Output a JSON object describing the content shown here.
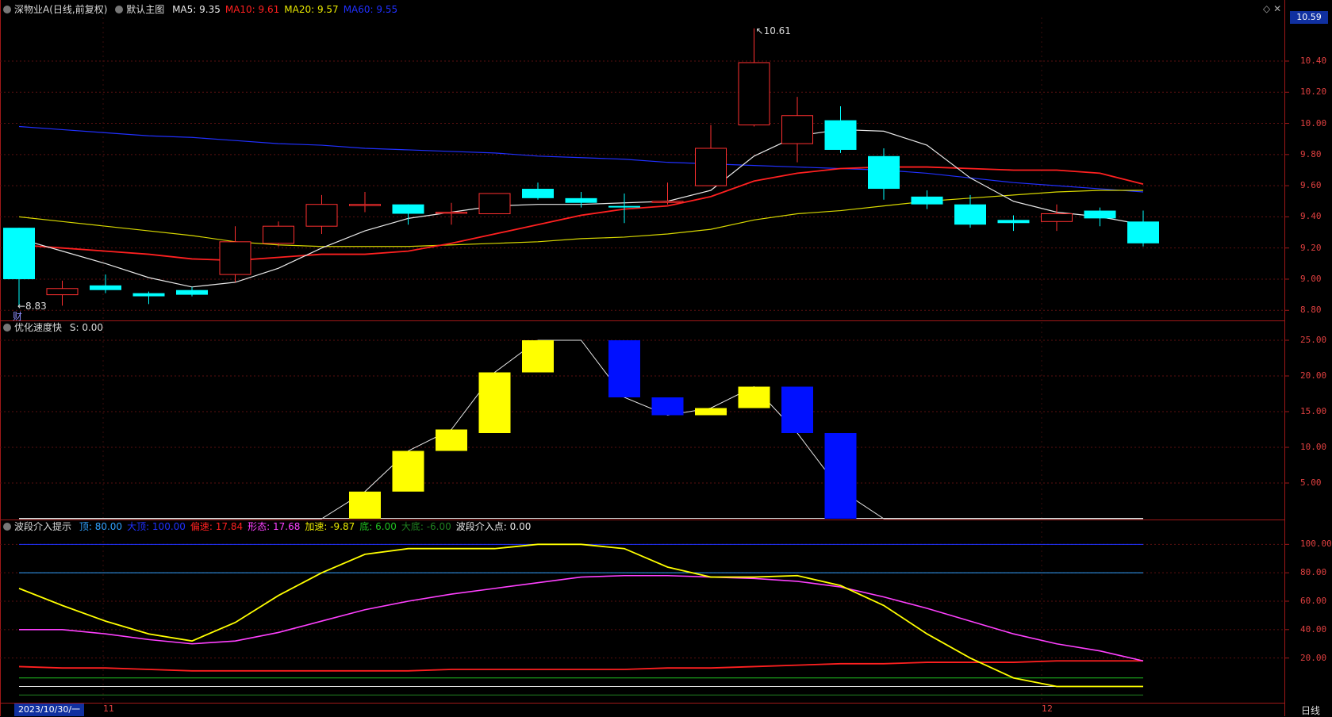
{
  "panel1": {
    "title": "深物业A(日线,前复权)",
    "subtitle": "默认主图",
    "indicators": [
      {
        "label": "MA5: 9.35",
        "color": "#e8e8e8"
      },
      {
        "label": "MA10: 9.61",
        "color": "#ff2020"
      },
      {
        "label": "MA20: 9.57",
        "color": "#e8e800"
      },
      {
        "label": "MA60: 9.55",
        "color": "#2030ff"
      }
    ],
    "current_price": "10.59",
    "high_mark": "10.61",
    "low_mark": "←8.83",
    "cai_mark": "财",
    "y_ticks": [
      "10.40",
      "10.20",
      "10.00",
      "9.80",
      "9.60",
      "9.40",
      "9.20",
      "9.00",
      "8.80"
    ]
  },
  "panel2": {
    "title": "优化速度快",
    "value": "S: 0.00",
    "y_ticks": [
      "25.00",
      "20.00",
      "15.00",
      "10.00",
      "5.00"
    ]
  },
  "panel3": {
    "title": "波段介入提示",
    "indicators": [
      {
        "label": "顶: 80.00",
        "color": "#30a0ff"
      },
      {
        "label": "大顶: 100.00",
        "color": "#2030ff"
      },
      {
        "label": "偏速: 17.84",
        "color": "#ff2020"
      },
      {
        "label": "形态: 17.68",
        "color": "#ff40ff"
      },
      {
        "label": "加速: -9.87",
        "color": "#e8e800"
      },
      {
        "label": "底: 6.00",
        "color": "#20c020"
      },
      {
        "label": "大底: -6.00",
        "color": "#208020"
      },
      {
        "label": "波段介入点: 0.00",
        "color": "#e8e8e8"
      }
    ],
    "y_ticks": [
      "100.00",
      "80.00",
      "60.00",
      "40.00",
      "20.00"
    ]
  },
  "footer": {
    "date": "2023/10/30/一",
    "month_11": "11",
    "month_12": "12",
    "period": "日线"
  },
  "colors": {
    "up": "#ff3030",
    "down": "#00ffff",
    "yellow": "#ffff00",
    "blue": "#0010ff"
  },
  "chart_data": {
    "type": "candlestick",
    "candles": [
      {
        "o": 9.33,
        "c": 9.0,
        "h": 9.33,
        "l": 8.83
      },
      {
        "o": 8.9,
        "c": 8.94,
        "h": 8.99,
        "l": 8.83
      },
      {
        "o": 8.96,
        "c": 8.93,
        "h": 9.03,
        "l": 8.91
      },
      {
        "o": 8.91,
        "c": 8.89,
        "h": 8.92,
        "l": 8.84
      },
      {
        "o": 8.93,
        "c": 8.9,
        "h": 8.95,
        "l": 8.89
      },
      {
        "o": 9.03,
        "c": 9.24,
        "h": 9.34,
        "l": 8.98
      },
      {
        "o": 9.23,
        "c": 9.34,
        "h": 9.37,
        "l": 9.21
      },
      {
        "o": 9.34,
        "c": 9.48,
        "h": 9.54,
        "l": 9.29
      },
      {
        "o": 9.48,
        "c": 9.48,
        "h": 9.56,
        "l": 9.43
      },
      {
        "o": 9.48,
        "c": 9.42,
        "h": 9.48,
        "l": 9.35
      },
      {
        "o": 9.43,
        "c": 9.43,
        "h": 9.49,
        "l": 9.35
      },
      {
        "o": 9.42,
        "c": 9.55,
        "h": 9.55,
        "l": 9.42
      },
      {
        "o": 9.58,
        "c": 9.52,
        "h": 9.62,
        "l": 9.51
      },
      {
        "o": 9.52,
        "c": 9.49,
        "h": 9.56,
        "l": 9.46
      },
      {
        "o": 9.47,
        "c": 9.46,
        "h": 9.55,
        "l": 9.36
      },
      {
        "o": 9.5,
        "c": 9.5,
        "h": 9.62,
        "l": 9.48
      },
      {
        "o": 9.6,
        "c": 9.84,
        "h": 9.99,
        "l": 9.6
      },
      {
        "o": 9.99,
        "c": 10.39,
        "h": 10.61,
        "l": 9.98
      },
      {
        "o": 9.87,
        "c": 10.05,
        "h": 10.17,
        "l": 9.75
      },
      {
        "o": 10.02,
        "c": 9.83,
        "h": 10.11,
        "l": 9.81
      },
      {
        "o": 9.79,
        "c": 9.58,
        "h": 9.84,
        "l": 9.51
      },
      {
        "o": 9.53,
        "c": 9.48,
        "h": 9.57,
        "l": 9.45
      },
      {
        "o": 9.48,
        "c": 9.35,
        "h": 9.54,
        "l": 9.33
      },
      {
        "o": 9.38,
        "c": 9.36,
        "h": 9.41,
        "l": 9.31
      },
      {
        "o": 9.37,
        "c": 9.42,
        "h": 9.48,
        "l": 9.31
      },
      {
        "o": 9.44,
        "c": 9.39,
        "h": 9.46,
        "l": 9.34
      },
      {
        "o": 9.37,
        "c": 9.23,
        "h": 9.44,
        "l": 9.21
      }
    ],
    "ma5": [
      9.26,
      9.18,
      9.1,
      9.01,
      8.95,
      8.98,
      9.07,
      9.2,
      9.31,
      9.39,
      9.43,
      9.47,
      9.48,
      9.48,
      9.49,
      9.5,
      9.57,
      9.79,
      9.92,
      9.96,
      9.95,
      9.86,
      9.65,
      9.5,
      9.43,
      9.4,
      9.35
    ],
    "ma10": [
      9.22,
      9.2,
      9.18,
      9.16,
      9.13,
      9.12,
      9.14,
      9.16,
      9.16,
      9.18,
      9.23,
      9.29,
      9.35,
      9.41,
      9.45,
      9.47,
      9.53,
      9.63,
      9.68,
      9.71,
      9.72,
      9.72,
      9.71,
      9.7,
      9.7,
      9.68,
      9.61
    ],
    "ma20": [
      9.4,
      9.37,
      9.34,
      9.31,
      9.28,
      9.24,
      9.22,
      9.21,
      9.21,
      9.21,
      9.22,
      9.23,
      9.24,
      9.26,
      9.27,
      9.29,
      9.32,
      9.38,
      9.42,
      9.44,
      9.47,
      9.5,
      9.52,
      9.54,
      9.56,
      9.57,
      9.57
    ],
    "ma60": [
      9.98,
      9.96,
      9.94,
      9.92,
      9.91,
      9.89,
      9.87,
      9.86,
      9.84,
      9.83,
      9.82,
      9.81,
      9.79,
      9.78,
      9.77,
      9.75,
      9.74,
      9.73,
      9.72,
      9.71,
      9.7,
      9.68,
      9.65,
      9.62,
      9.6,
      9.58,
      9.56
    ],
    "speed_bars": [
      {
        "i": 8,
        "o": 0,
        "c": 3.8,
        "col": "y"
      },
      {
        "i": 9,
        "o": 3.8,
        "c": 9.5,
        "col": "y"
      },
      {
        "i": 10,
        "o": 9.5,
        "c": 12.5,
        "col": "y"
      },
      {
        "i": 11,
        "o": 12.0,
        "c": 20.5,
        "col": "y"
      },
      {
        "i": 12,
        "o": 20.5,
        "c": 25.0,
        "col": "y"
      },
      {
        "i": 14,
        "o": 25.0,
        "c": 17.0,
        "col": "b"
      },
      {
        "i": 15,
        "o": 17.0,
        "c": 14.5,
        "col": "b"
      },
      {
        "i": 16,
        "o": 14.5,
        "c": 15.5,
        "col": "y"
      },
      {
        "i": 17,
        "o": 15.5,
        "c": 18.5,
        "col": "y"
      },
      {
        "i": 18,
        "o": 18.5,
        "c": 12.0,
        "col": "b"
      },
      {
        "i": 19,
        "o": 12.0,
        "c": 0,
        "col": "b"
      }
    ],
    "speed_line": [
      0,
      0,
      0,
      0,
      0,
      0,
      0,
      0,
      3.8,
      9.5,
      12.5,
      20.5,
      25,
      25,
      17,
      14.5,
      15.5,
      18.5,
      12,
      4,
      0,
      0,
      0,
      0,
      0,
      0,
      0
    ],
    "band_yellow": [
      69,
      57,
      46,
      37,
      32,
      45,
      64,
      80,
      93,
      97,
      97,
      97,
      100,
      100,
      97,
      84,
      77,
      77,
      78,
      71,
      57,
      37,
      20,
      6,
      0,
      0,
      0
    ],
    "band_magenta": [
      40,
      40,
      37,
      33,
      30,
      32,
      38,
      46,
      54,
      60,
      65,
      69,
      73,
      77,
      78,
      78,
      77,
      76,
      74,
      70,
      63,
      55,
      46,
      37,
      30,
      25,
      18
    ],
    "band_red": [
      14,
      13,
      13,
      12,
      11,
      11,
      11,
      11,
      11,
      11,
      12,
      12,
      12,
      12,
      12,
      13,
      13,
      14,
      15,
      16,
      16,
      17,
      17,
      17,
      18,
      18,
      18
    ],
    "y_ranges": {
      "price": [
        8.73,
        10.68
      ],
      "speed": [
        0,
        26
      ],
      "band": [
        -12,
        108
      ]
    }
  }
}
